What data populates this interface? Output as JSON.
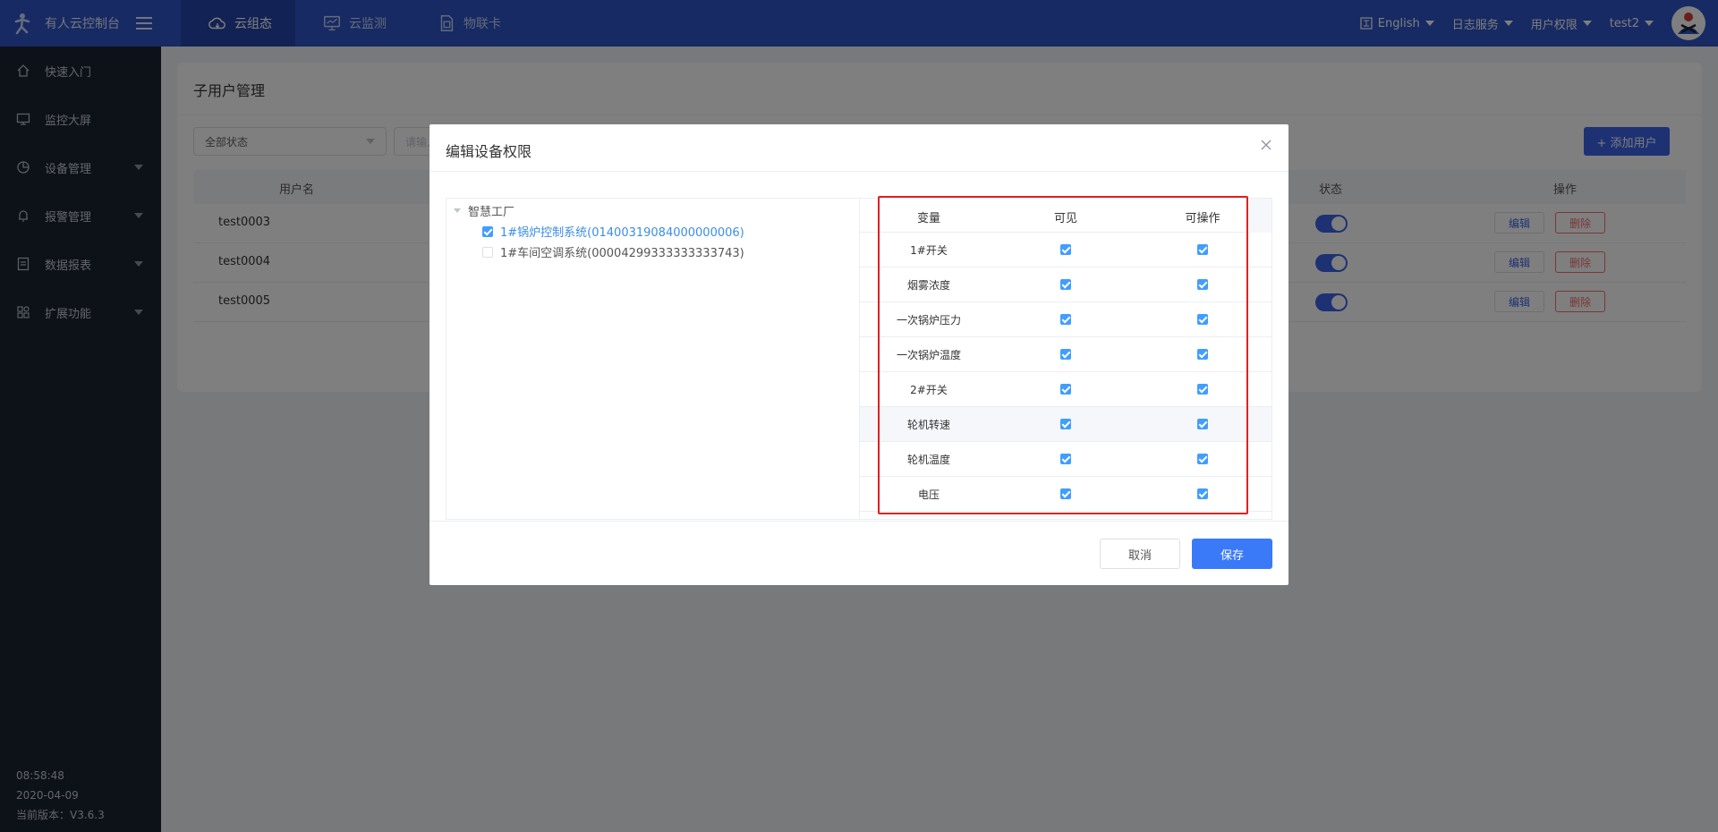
{
  "header": {
    "brand": "有人云控制台",
    "tabs": [
      {
        "label": "云组态",
        "icon": "cloud-icon",
        "active": true
      },
      {
        "label": "云监测",
        "icon": "monitor-icon",
        "active": false
      },
      {
        "label": "物联卡",
        "icon": "sim-card-icon",
        "active": false
      }
    ],
    "language": "English",
    "log_service": "日志服务",
    "user_permissions": "用户权限",
    "username": "test2"
  },
  "sidebar": {
    "items": [
      {
        "label": "快速入门",
        "icon": "home-icon"
      },
      {
        "label": "监控大屏",
        "icon": "screen-icon"
      },
      {
        "label": "设备管理",
        "icon": "device-icon"
      },
      {
        "label": "报警管理",
        "icon": "alarm-icon"
      },
      {
        "label": "数据报表",
        "icon": "report-icon"
      },
      {
        "label": "扩展功能",
        "icon": "apps-icon"
      }
    ],
    "time": "08:58:48",
    "date": "2020-04-09",
    "version": "当前版本：V3.6.3"
  },
  "page": {
    "title": "子用户管理",
    "status_filter": "全部状态",
    "search_placeholder": "请输入",
    "add_user": "+ 添加用户",
    "columns": {
      "username": "用户名",
      "status": "状态",
      "actions": "操作"
    },
    "users": [
      {
        "name": "test0003",
        "enabled": true
      },
      {
        "name": "test0004",
        "enabled": true
      },
      {
        "name": "test0005",
        "enabled": true
      }
    ],
    "edit_label": "编辑",
    "delete_label": "删除"
  },
  "dialog": {
    "title": "编辑设备权限",
    "tree": {
      "root": "智慧工厂",
      "nodes": [
        {
          "label": "1#锅炉控制系统(01400319084000000006)",
          "checked": true
        },
        {
          "label": "1#车间空调系统(00004299333333333743)",
          "checked": false
        }
      ]
    },
    "table": {
      "headers": {
        "variable": "变量",
        "visible": "可见",
        "operable": "可操作"
      },
      "rows": [
        {
          "name": "1#开关",
          "visible": true,
          "operable": true
        },
        {
          "name": "烟雾浓度",
          "visible": true,
          "operable": true
        },
        {
          "name": "一次锅炉压力",
          "visible": true,
          "operable": true
        },
        {
          "name": "一次锅炉温度",
          "visible": true,
          "operable": true
        },
        {
          "name": "2#开关",
          "visible": true,
          "operable": true
        },
        {
          "name": "轮机转速",
          "visible": true,
          "operable": true
        },
        {
          "name": "轮机温度",
          "visible": true,
          "operable": true
        },
        {
          "name": "电压",
          "visible": true,
          "operable": true
        }
      ]
    },
    "cancel": "取消",
    "save": "保存"
  }
}
